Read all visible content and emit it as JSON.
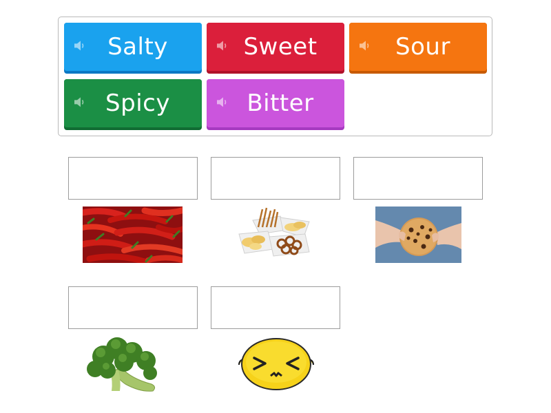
{
  "word_bank": {
    "tiles": [
      {
        "label": "Salty",
        "color": "#1aa2ee",
        "icon": "speaker-icon"
      },
      {
        "label": "Sweet",
        "color": "#db1f3b",
        "icon": "speaker-icon"
      },
      {
        "label": "Sour",
        "color": "#f57510",
        "icon": "speaker-icon"
      },
      {
        "label": "Spicy",
        "color": "#1b8f45",
        "icon": "speaker-icon"
      },
      {
        "label": "Bitter",
        "color": "#cb55dd",
        "icon": "speaker-icon"
      }
    ]
  },
  "targets": [
    {
      "image": "chili-peppers",
      "answer": ""
    },
    {
      "image": "pretzels-chips",
      "answer": ""
    },
    {
      "image": "cookie",
      "answer": ""
    },
    {
      "image": "broccoli",
      "answer": ""
    },
    {
      "image": "sour-lemon-face",
      "answer": ""
    }
  ]
}
